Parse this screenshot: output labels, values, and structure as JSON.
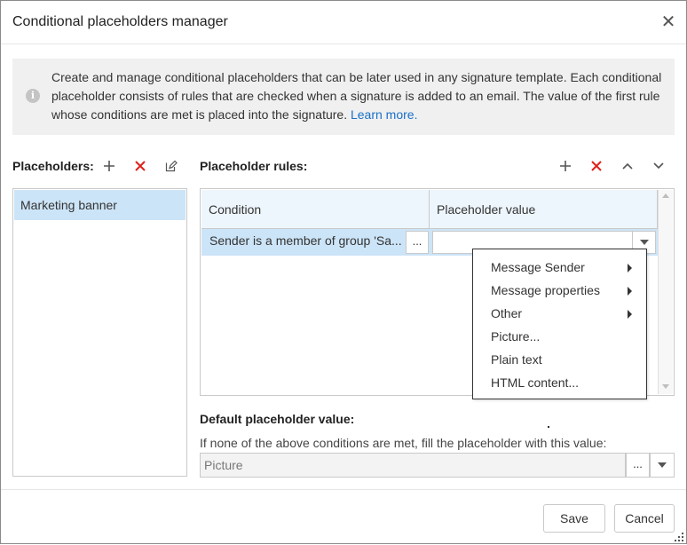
{
  "dialog": {
    "title": "Conditional placeholders manager",
    "close_icon": "close-icon"
  },
  "info": {
    "icon": "info-icon",
    "text": "Create and manage conditional placeholders that can be later used in any signature template. Each conditional placeholder consists of rules that are checked when a signature is added to an email. The value of the first rule whose conditions are met is placed into the signature.",
    "link_text": "Learn more."
  },
  "placeholders": {
    "label": "Placeholders:",
    "toolbar": [
      "add-icon",
      "delete-icon",
      "edit-icon"
    ],
    "items": [
      {
        "label": "Marketing banner",
        "selected": true
      }
    ]
  },
  "rules": {
    "label": "Placeholder rules:",
    "toolbar": [
      "add-icon",
      "delete-icon",
      "move-up-icon",
      "move-down-icon"
    ],
    "columns": [
      "Condition",
      "Placeholder value"
    ],
    "rows": [
      {
        "condition": "Sender is a member of group 'Sa...",
        "condition_button": "...",
        "value": ""
      }
    ]
  },
  "value_menu": {
    "items": [
      {
        "label": "Message Sender",
        "submenu": true
      },
      {
        "label": "Message properties",
        "submenu": true
      },
      {
        "label": "Other",
        "submenu": true
      },
      {
        "label": "Picture...",
        "submenu": false
      },
      {
        "label": "Plain text",
        "submenu": false
      },
      {
        "label": "HTML content...",
        "submenu": false
      }
    ]
  },
  "default_value": {
    "label": "Default placeholder value:",
    "hint": "If none of the above conditions are met, fill the placeholder with this value:",
    "value": "Picture",
    "dots": "..."
  },
  "footer": {
    "save_label": "Save",
    "cancel_label": "Cancel"
  },
  "colors": {
    "accent": "#1a6fc9",
    "delete": "#e0201b",
    "selection": "#cce4f7",
    "header": "#eef6fd"
  }
}
